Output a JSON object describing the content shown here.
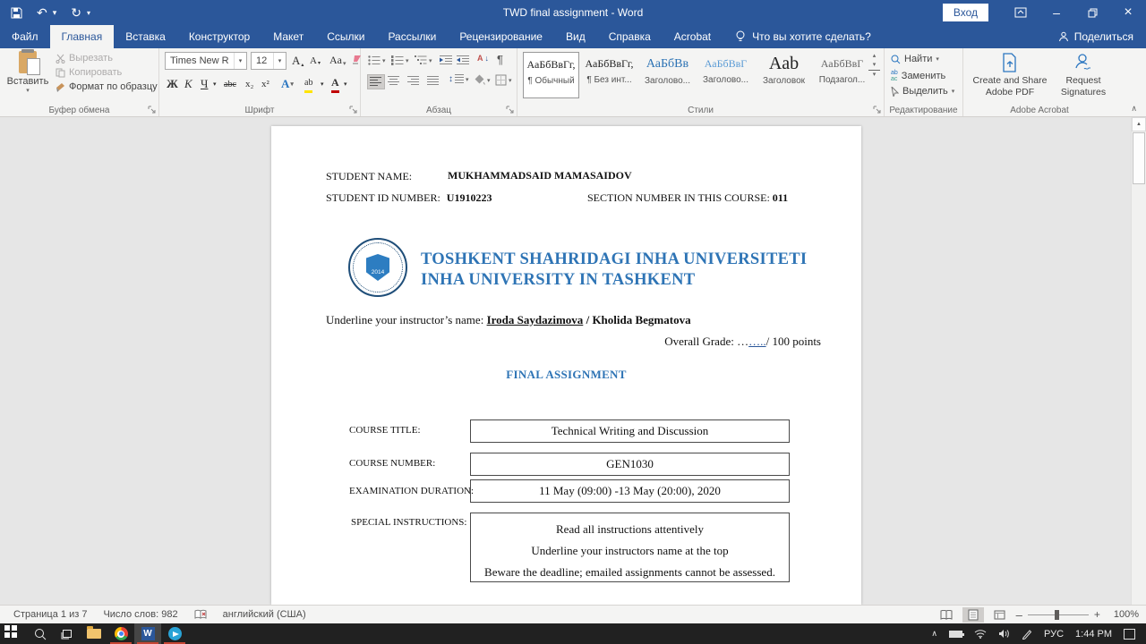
{
  "titlebar": {
    "title": "TWD final assignment  -  Word",
    "signin_label": "Вход"
  },
  "tabs": {
    "file": "Файл",
    "items": [
      "Главная",
      "Вставка",
      "Конструктор",
      "Макет",
      "Ссылки",
      "Рассылки",
      "Рецензирование",
      "Вид",
      "Справка",
      "Acrobat"
    ],
    "tellme": "Что вы хотите сделать?",
    "share": "Поделиться"
  },
  "ribbon": {
    "clipboard": {
      "paste": "Вставить",
      "cut": "Вырезать",
      "copy": "Копировать",
      "format_painter": "Формат по образцу",
      "group": "Буфер обмена"
    },
    "font": {
      "name": "Times New R",
      "size": "12",
      "bold": "Ж",
      "italic": "К",
      "underline": "Ч",
      "strike": "abc",
      "subscript": "x₂",
      "superscript": "x²",
      "case": "Aa",
      "grow": "A",
      "shrink": "A",
      "effects": "A",
      "highlight": "ab",
      "color_letter": "А",
      "group": "Шрифт"
    },
    "paragraph": {
      "sort_top": "А",
      "sort_arrow": "↓",
      "group": "Абзац"
    },
    "styles": {
      "group": "Стили",
      "items": [
        {
          "sample": "АаБбВвГг,",
          "label": "¶ Обычный"
        },
        {
          "sample": "АаБбВвГг,",
          "label": "¶ Без инт..."
        },
        {
          "sample": "АаБбВв",
          "label": "Заголово..."
        },
        {
          "sample": "АаБбВвГ",
          "label": "Заголово..."
        },
        {
          "sample": "Aab",
          "label": "Заголовок"
        },
        {
          "sample": "АаБбВвГ",
          "label": "Подзагол..."
        }
      ]
    },
    "editing": {
      "find": "Найти",
      "replace": "Заменить",
      "select": "Выделить",
      "group": "Редактирование"
    },
    "acrobat": {
      "create_line1": "Create and Share",
      "create_line2": "Adobe PDF",
      "request_line1": "Request",
      "request_line2": "Signatures",
      "group": "Adobe Acrobat"
    }
  },
  "document": {
    "student_name_label": "STUDENT NAME:",
    "student_name": "MUKHAMMADSAID MAMASAIDOV",
    "student_id_label": "STUDENT ID NUMBER:",
    "student_id": "U1910223",
    "section_label": "SECTION NUMBER IN THIS COURSE:",
    "section_value": "011",
    "university_line1": "TOSHKENT SHAHRIDAGI INHA UNIVERSITETI",
    "university_line2": "INHA UNIVERSITY IN TASHKENT",
    "logo_year": "2014",
    "instructor_label": "Underline your instructor’s name: ",
    "instructor1": "Iroda Saydazimova",
    "instructor_sep": " / ",
    "instructor2": "Kholida Begmatova",
    "grade_label": "Overall Grade: ",
    "grade_dots_plain": "…",
    "grade_dots_link": "…..",
    "grade_points": "/ 100 points",
    "heading": "FINAL ASSIGNMENT",
    "fields": [
      {
        "label": "COURSE TITLE:",
        "value": "Technical Writing and Discussion"
      },
      {
        "label": "COURSE NUMBER:",
        "value": "GEN1030"
      },
      {
        "label": "EXAMINATION DURATION:",
        "value": "11 May (09:00) -13 May (20:00), 2020"
      }
    ],
    "special_label": "SPECIAL INSTRUCTIONS:",
    "special_lines": [
      "Read all instructions attentively",
      "Underline your instructors name at the top",
      "Beware the deadline; emailed assignments cannot be assessed."
    ]
  },
  "statusbar": {
    "page": "Страница 1 из 7",
    "words": "Число слов: 982",
    "language": "английский (США)",
    "zoom_level": "100%"
  },
  "taskbar": {
    "lang": "РУС",
    "time": "1:44 PM"
  },
  "icons": {
    "dropdown": "▾",
    "dropup": "▴",
    "undo": "↶",
    "redo": "↻",
    "minimize": "–",
    "close": "×",
    "collapse": "∧",
    "scroll_up": "▲",
    "pilcrow": "¶",
    "updown": "↕",
    "word_letter": "W",
    "tray_chevron": "∧"
  },
  "colors": {
    "accent_blue": "#2b579a",
    "doc_heading_blue": "#2e74b5",
    "running_indicator": "#c74634",
    "highlight_yellow": "#ffe400",
    "font_color_red": "#c00000",
    "telegram_blue": "#29a3d6"
  }
}
